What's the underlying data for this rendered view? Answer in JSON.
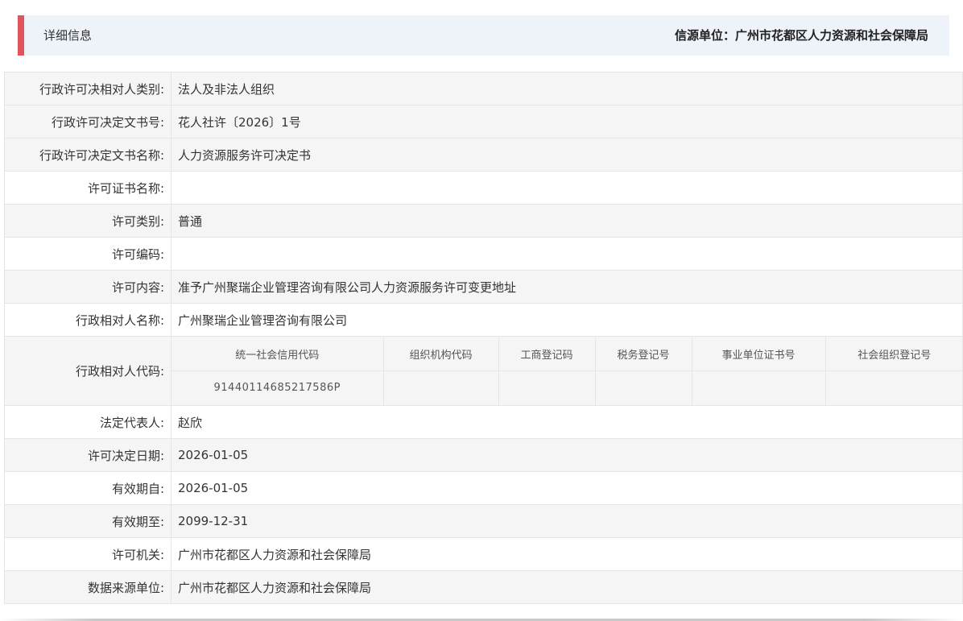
{
  "header": {
    "title": "详细信息",
    "source_label": "信源单位：",
    "source_name": "广州市花都区人力资源和社会保障局",
    "accent_color": "#e2545b"
  },
  "rows": [
    {
      "label": "行政许可决相对人类别:",
      "value": "法人及非法人组织"
    },
    {
      "label": "行政许可决定文书号:",
      "value": "花人社许〔2026〕1号"
    },
    {
      "label": "行政许可决定文书名称:",
      "value": "人力资源服务许可决定书"
    },
    {
      "label": "许可证书名称:",
      "value": ""
    },
    {
      "label": "许可类别:",
      "value": "普通"
    },
    {
      "label": "许可编码:",
      "value": ""
    },
    {
      "label": "许可内容:",
      "value": "准予广州聚瑞企业管理咨询有限公司人力资源服务许可变更地址"
    },
    {
      "label": "行政相对人名称:",
      "value": "广州聚瑞企业管理咨询有限公司"
    }
  ],
  "code_row": {
    "label": "行政相对人代码:",
    "headers": [
      "统一社会信用代码",
      "组织机构代码",
      "工商登记码",
      "税务登记号",
      "事业单位证书号",
      "社会组织登记号"
    ],
    "values": [
      "91440114685217586P",
      "",
      "",
      "",
      "",
      ""
    ]
  },
  "rows_after": [
    {
      "label": "法定代表人:",
      "value": "赵欣"
    },
    {
      "label": "许可决定日期:",
      "value": "2026-01-05"
    },
    {
      "label": "有效期自:",
      "value": "2026-01-05"
    },
    {
      "label": "有效期至:",
      "value": "2099-12-31"
    },
    {
      "label": "许可机关:",
      "value": "广州市花都区人力资源和社会保障局"
    },
    {
      "label": "数据来源单位:",
      "value": "广州市花都区人力资源和社会保障局"
    }
  ]
}
